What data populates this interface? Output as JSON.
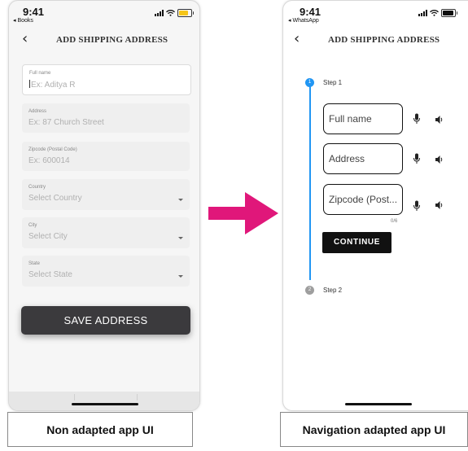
{
  "left_phone": {
    "status": {
      "time": "9:41",
      "back_app": "◂ Books"
    },
    "title": "ADD SHIPPING ADDRESS",
    "fields": [
      {
        "label": "Full name",
        "placeholder": "Ex: Aditya R"
      },
      {
        "label": "Address",
        "placeholder": "Ex: 87 Church Street"
      },
      {
        "label": "Zipcode (Postal Code)",
        "placeholder": "Ex: 600014"
      },
      {
        "label": "Country",
        "placeholder": "Select Country"
      },
      {
        "label": "City",
        "placeholder": "Select City"
      },
      {
        "label": "State",
        "placeholder": "Select State"
      }
    ],
    "save_label": "SAVE ADDRESS",
    "battery_color": "#f5c518"
  },
  "right_phone": {
    "status": {
      "time": "9:41",
      "back_app": "◂ WhatsApp"
    },
    "title": "ADD SHIPPING ADDRESS",
    "steps": [
      {
        "number": "1",
        "label": "Step 1",
        "color": "#2196f3"
      },
      {
        "number": "2",
        "label": "Step 2",
        "color": "#9e9e9e"
      }
    ],
    "fields": [
      {
        "text": "Full name"
      },
      {
        "text": "Address"
      },
      {
        "text": "Zipcode (Post..."
      }
    ],
    "zipcode_counter": "0/6",
    "continue_label": "CONTINUE",
    "mic_icon": "mic-icon",
    "speaker_icon": "speaker-icon"
  },
  "captions": {
    "left": "Non adapted app UI",
    "right": "Navigation adapted app UI"
  },
  "colors": {
    "arrow": "#e0177a",
    "accent": "#2196f3"
  }
}
